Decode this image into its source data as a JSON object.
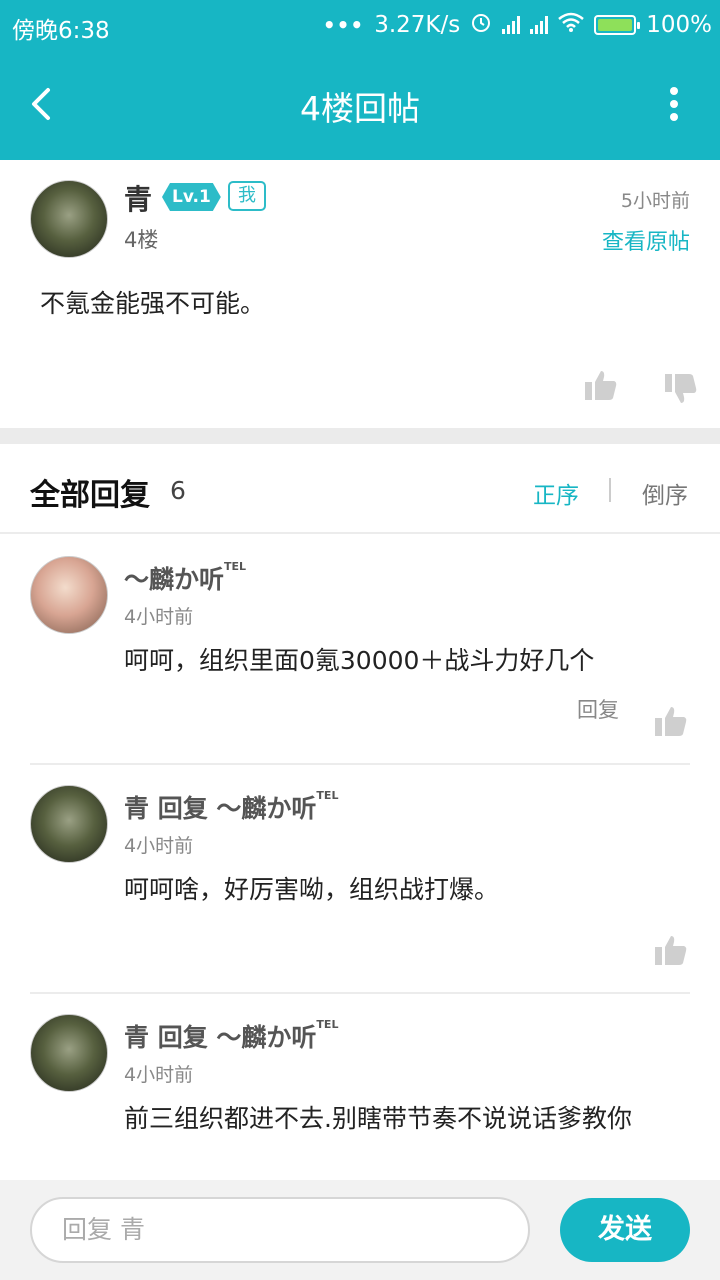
{
  "status": {
    "time": "傍晚6:38",
    "speed": "3.27K/s",
    "battery": "100%",
    "icons": [
      "alarm-icon",
      "signal-icon",
      "wifi-icon",
      "battery-icon"
    ]
  },
  "appbar": {
    "title": "4楼回帖"
  },
  "post": {
    "user": "青",
    "level": "Lv.1",
    "me_badge": "我",
    "floor": "4楼",
    "time": "5小时前",
    "view_original": "查看原帖",
    "content": "不氪金能强不可能。"
  },
  "replies_header": {
    "title": "全部回复",
    "count": "6",
    "sort_asc": "正序",
    "sort_desc": "倒序"
  },
  "replies": [
    {
      "user": "～麟か听",
      "tag": "TEL",
      "time": "4小时前",
      "text": "呵呵，组织里面0氪30000＋战斗力好几个",
      "reply_label": "回复"
    },
    {
      "user": "青 回复 ～麟か听",
      "tag": "TEL",
      "time": "4小时前",
      "text": "呵呵啥，好厉害呦，组织战打爆。"
    },
    {
      "user": "青 回复 ～麟か听",
      "tag": "TEL",
      "time": "4小时前",
      "text": "前三组织都进不去.别瞎带节奏不说说话爹教你"
    }
  ],
  "composer": {
    "placeholder": "回复 青",
    "send_label": "发送"
  },
  "colors": {
    "accent": "#17b6c4",
    "like_gray": "#cfcfcf"
  }
}
